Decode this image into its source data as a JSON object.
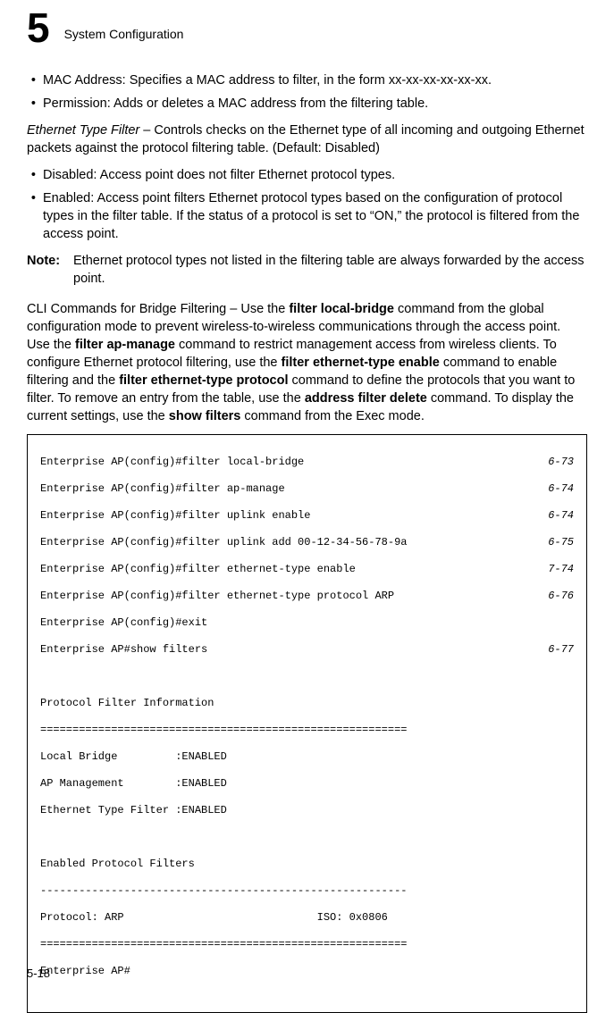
{
  "header": {
    "chapter_number": "5",
    "chapter_title": "System Configuration"
  },
  "body": {
    "bullet1_a": "MAC Address: Specifies a MAC address to filter, in the form xx-xx-xx-xx-xx-xx.",
    "bullet1_b": "Permission: Adds or deletes a MAC address from the filtering table.",
    "eth_filter_label": "Ethernet Type Filter",
    "eth_filter_text": " – Controls checks on the Ethernet type of all incoming and outgoing Ethernet packets against the protocol filtering table. (Default: Disabled)",
    "bullet2_a": "Disabled: Access point does not filter Ethernet protocol types.",
    "bullet2_b": "Enabled: Access point filters Ethernet protocol types based on the configuration of protocol types in the filter table. If the status of a protocol is set to “ON,” the protocol is filtered from the access point.",
    "note_label": "Note:",
    "note_text": "Ethernet protocol types not listed in the filtering table are always forwarded by the access point.",
    "cli_intro_1": "CLI Commands for Bridge Filtering – Use the ",
    "cli_cmd_1": "filter local-bridge",
    "cli_intro_2": " command from the global configuration mode to prevent wireless-to-wireless communications through the access point. Use the ",
    "cli_cmd_2": "filter ap-manage",
    "cli_intro_3": " command to restrict management access from wireless clients. To configure Ethernet protocol filtering, use the ",
    "cli_cmd_3": "filter ethernet-type enable",
    "cli_intro_4": " command to enable filtering and the ",
    "cli_cmd_4": "filter ethernet-type protocol",
    "cli_intro_5": " command to define the protocols that you want to filter. To remove an entry from the table, use the ",
    "cli_cmd_5": "address filter delete",
    "cli_intro_6": " command. To display the current settings, use the ",
    "cli_cmd_6": "show filters",
    "cli_intro_7": " command from the Exec mode."
  },
  "code": {
    "lines": [
      {
        "t": "Enterprise AP(config)#filter local-bridge",
        "r": "6-73"
      },
      {
        "t": "Enterprise AP(config)#filter ap-manage",
        "r": "6-74"
      },
      {
        "t": "Enterprise AP(config)#filter uplink enable",
        "r": "6-74"
      },
      {
        "t": "Enterprise AP(config)#filter uplink add 00-12-34-56-78-9a",
        "r": "6-75"
      },
      {
        "t": "Enterprise AP(config)#filter ethernet-type enable",
        "r": "7-74"
      },
      {
        "t": "Enterprise AP(config)#filter ethernet-type protocol ARP",
        "r": "6-76"
      },
      {
        "t": "Enterprise AP(config)#exit",
        "r": ""
      },
      {
        "t": "Enterprise AP#show filters",
        "r": "6-77"
      }
    ],
    "blank1": "",
    "info_hdr": "Protocol Filter Information",
    "sep_eq": "=========================================================",
    "lb": "Local Bridge         :ENABLED",
    "apm": "AP Management        :ENABLED",
    "etf": "Ethernet Type Filter :ENABLED",
    "blank2": "",
    "epf_hdr": "Enabled Protocol Filters",
    "sep_dash": "---------------------------------------------------------",
    "proto": "Protocol: ARP                              ISO: 0x0806",
    "sep_eq2": "=========================================================",
    "prompt": "Enterprise AP#"
  },
  "footer": {
    "page_number": "5-18"
  }
}
